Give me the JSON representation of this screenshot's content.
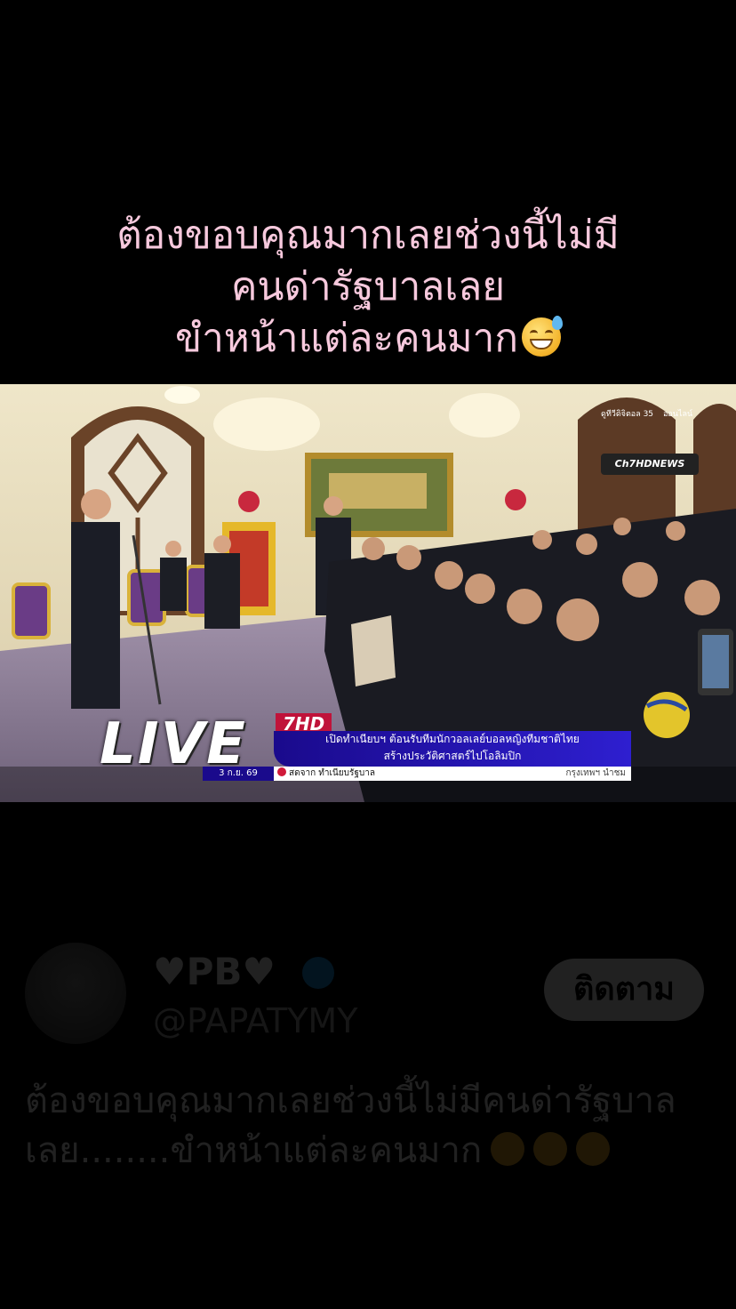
{
  "caption": {
    "line1": "ต้องขอบคุณมากเลยช่วงนี้ไม่มี",
    "line2": "คนด่ารัฐบาลเลย",
    "line3": "ขำหน้าแต่ละคนมาก",
    "emoji": "sweat-smile-emoji"
  },
  "video": {
    "live_label": "LIVE",
    "hd_tag": "7HD",
    "headline_1": "เปิดทำเนียบฯ ต้อนรับทีมนักวอลเลย์บอลหญิงทีมชาติไทย",
    "headline_2": "สร้างประวัติศาสตร์ไปโอลิมปิก",
    "date": "3 ก.ย. 69",
    "source": "สดจาก ทำเนียบรัฐบาล",
    "place": "กรุงเทพฯ นำชม",
    "channel_logo": "Ch7HDNEWS",
    "channel_number": "ดูทีวีดิจิตอล 35",
    "channel_corner": "ออนไลน์"
  },
  "tweet": {
    "display_name": "♥PB♥",
    "handle": "@PAPATYMY",
    "follow_label": "ติดตาม",
    "text_line1": "ต้องขอบคุณมากเลยช่วงนี้ไม่มีคนด่ารัฐบาล",
    "text_line2": "เลย........ขำหน้าแต่ละคนมาก"
  },
  "colors": {
    "caption": "#f7c9dd",
    "background": "#000000",
    "news_bar": "#1a0a8c",
    "accent_red": "#c0133a"
  }
}
